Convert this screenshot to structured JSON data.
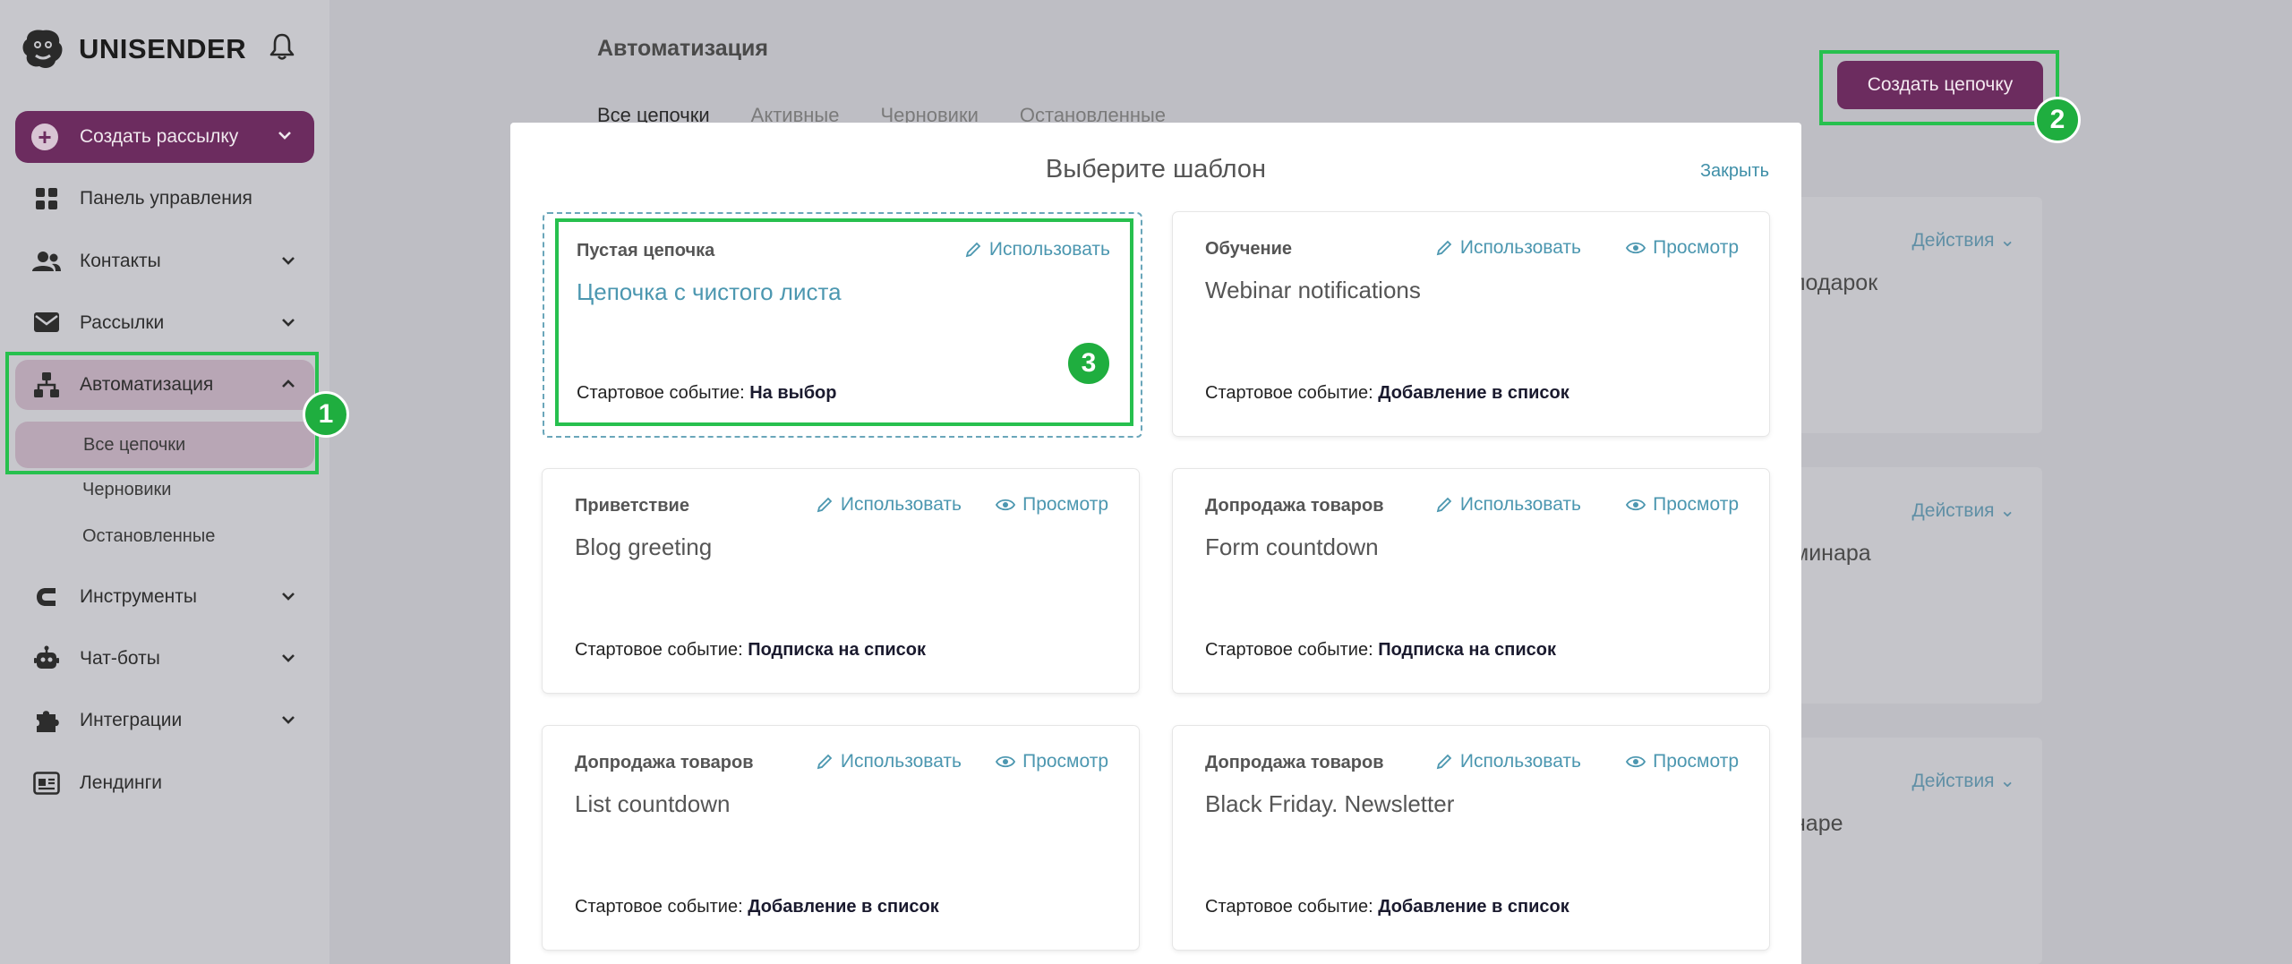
{
  "app": {
    "logo_text": "UNISENDER"
  },
  "sidebar": {
    "create_label": "Создать рассылку",
    "items": [
      {
        "label": "Панель управления"
      },
      {
        "label": "Контакты"
      },
      {
        "label": "Рассылки"
      },
      {
        "label": "Автоматизация"
      },
      {
        "label": "Инструменты"
      },
      {
        "label": "Чат-боты"
      },
      {
        "label": "Интеграции"
      },
      {
        "label": "Лендинги"
      }
    ],
    "subitems": [
      {
        "label": "Все цепочки"
      },
      {
        "label": "Черновики"
      },
      {
        "label": "Остановленные"
      }
    ]
  },
  "main": {
    "title": "Автоматизация",
    "tabs": [
      "Все цепочки",
      "Активные",
      "Черновики",
      "Остановленные"
    ],
    "create_chain_label": "Создать цепочку",
    "bg_cards": [
      {
        "action": "Действия",
        "fragment": "подарок"
      },
      {
        "action": "Действия",
        "fragment": "минара"
      },
      {
        "action": "Действия",
        "fragment": "наре"
      }
    ]
  },
  "modal": {
    "title": "Выберите шаблон",
    "close_label": "Закрыть",
    "use_label": "Использовать",
    "view_label": "Просмотр",
    "start_prefix": "Стартовое событие:",
    "templates": [
      {
        "category": "Пустая цепочка",
        "name": "Цепочка с чистого листа",
        "start_event": "На выбор"
      },
      {
        "category": "Обучение",
        "name": "Webinar notifications",
        "start_event": "Добавление в список"
      },
      {
        "category": "Приветствие",
        "name": "Blog greeting",
        "start_event": "Подписка на список"
      },
      {
        "category": "Допродажа товаров",
        "name": "Form countdown",
        "start_event": "Подписка на список"
      },
      {
        "category": "Допродажа товаров",
        "name": "List countdown",
        "start_event": "Добавление в список"
      },
      {
        "category": "Допродажа товаров",
        "name": "Black Friday. Newsletter",
        "start_event": "Добавление в список"
      }
    ]
  },
  "annotations": {
    "badge1": "1",
    "badge2": "2",
    "badge3": "3"
  },
  "colors": {
    "brand": "#6c2c5f",
    "link": "#4c97b0",
    "highlight": "#27c04e"
  }
}
